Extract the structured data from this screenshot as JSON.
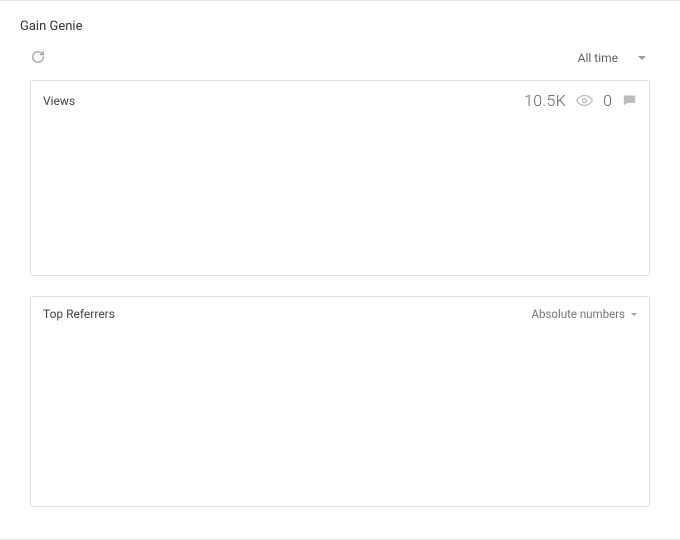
{
  "page": {
    "title": "Gain Genie"
  },
  "toolbar": {
    "time_filter_label": "All time"
  },
  "views_card": {
    "title": "Views",
    "views_count": "10.5K",
    "comments_count": "0"
  },
  "referrers_card": {
    "title": "Top Referrers",
    "mode_label": "Absolute numbers"
  }
}
